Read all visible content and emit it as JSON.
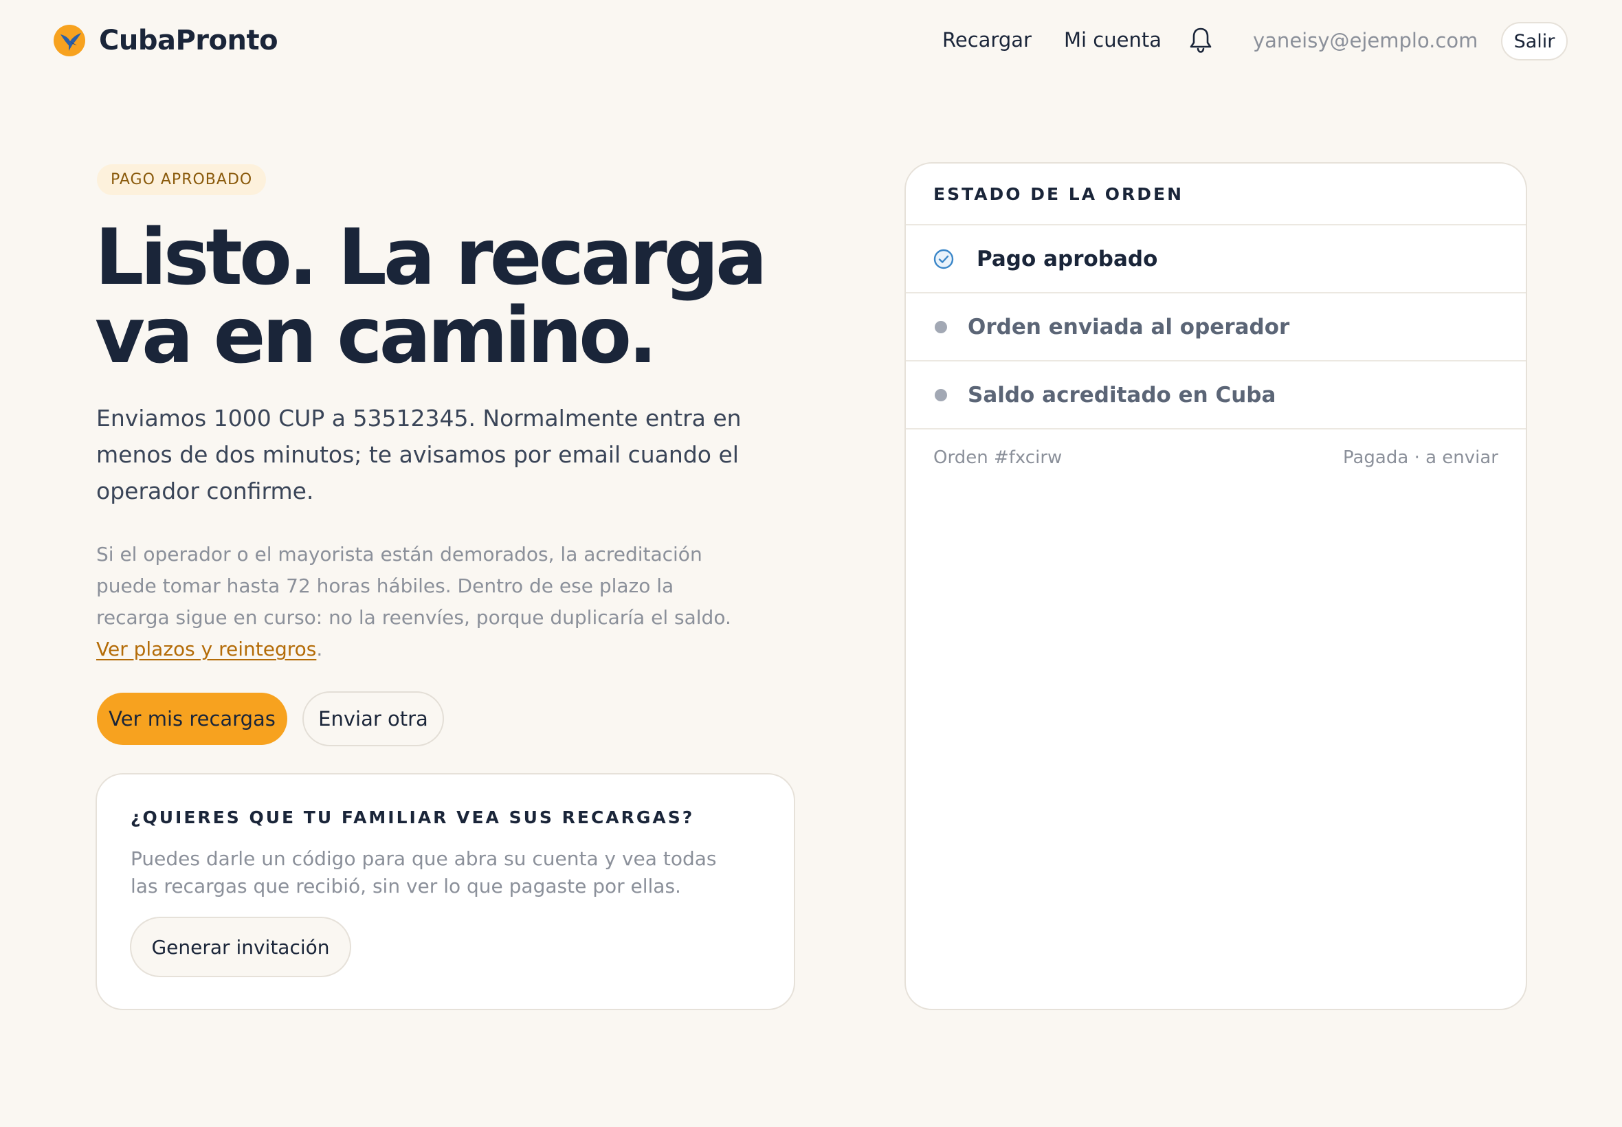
{
  "header": {
    "brand": "CubaPronto",
    "nav": {
      "recargar": "Recargar",
      "cuenta": "Mi cuenta"
    },
    "email": "yaneisy@ejemplo.com",
    "logout_label": "Salir"
  },
  "main": {
    "badge": "PAGO APROBADO",
    "headline": "Listo. La recarga va en camino.",
    "lede": "Enviamos 1000 CUP a 53512345. Normalmente entra en menos de dos minutos; te avisamos por email cuando el operador confirme.",
    "fine_text": "Si el operador o el mayorista están demorados, la acreditación puede tomar hasta 72 horas hábiles. Dentro de ese plazo la recarga sigue en curso: no la reenvíes, porque duplicaría el saldo.",
    "fine_link": "Ver plazos y reintegros",
    "fine_end": ".",
    "primary_button": "Ver mis recargas",
    "secondary_button": "Enviar otra"
  },
  "invite": {
    "title": "¿QUIERES QUE TU FAMILIAR VEA SUS RECARGAS?",
    "description": "Puedes darle un código para que abra su cuenta y vea todas las recargas que recibió, sin ver lo que pagaste por ellas.",
    "button": "Generar invitación"
  },
  "status": {
    "title": "ESTADO DE LA ORDEN",
    "steps": [
      {
        "label": "Pago aprobado",
        "state": "done"
      },
      {
        "label": "Orden enviada al operador",
        "state": "pending"
      },
      {
        "label": "Saldo acreditado en Cuba",
        "state": "pending"
      }
    ],
    "order_id": "Orden #fxcirw",
    "order_state": "Pagada · a enviar"
  },
  "colors": {
    "accent": "#f7a21f",
    "text_dark": "#1a2539",
    "muted": "#8b909a",
    "link": "#b46c08",
    "background": "#faf7f2",
    "check": "#3a86c8"
  }
}
